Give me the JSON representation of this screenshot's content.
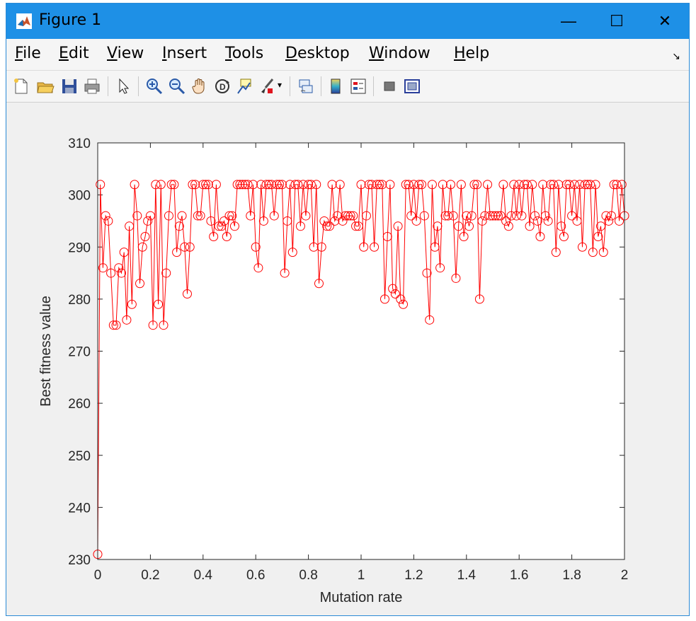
{
  "window": {
    "title": "Figure 1"
  },
  "title_controls": {
    "minimize": "—",
    "maximize": "☐",
    "close": "✕"
  },
  "menu": [
    {
      "label": "File",
      "key": "F",
      "rest": "ile"
    },
    {
      "label": "Edit",
      "key": "E",
      "rest": "dit"
    },
    {
      "label": "View",
      "key": "V",
      "rest": "iew"
    },
    {
      "label": "Insert",
      "key": "I",
      "rest": "nsert"
    },
    {
      "label": "Tools",
      "key": "T",
      "rest": "ools"
    },
    {
      "label": "Desktop",
      "key": "D",
      "rest": "esktop"
    },
    {
      "label": "Window",
      "key": "W",
      "rest": "indow"
    },
    {
      "label": "Help",
      "key": "H",
      "rest": "elp"
    }
  ],
  "toolbar_icons": [
    "new-figure-icon",
    "open-file-icon",
    "save-icon",
    "print-icon",
    "pointer-icon",
    "zoom-in-icon",
    "zoom-out-icon",
    "pan-icon",
    "rotate-3d-icon",
    "data-cursor-icon",
    "brush-icon",
    "dropdown-arrow-icon",
    "link-plot-icon",
    "colorbar-icon",
    "legend-icon",
    "hide-plot-tools-icon",
    "show-plot-tools-icon"
  ],
  "colors": {
    "titlebar": "#1e90e6",
    "series": "#ff0000"
  },
  "chart_data": {
    "type": "line",
    "xlabel": "Mutation rate",
    "ylabel": "Best fitness value",
    "xlim": [
      0,
      2
    ],
    "ylim": [
      230,
      310
    ],
    "xticks": [
      0,
      0.2,
      0.4,
      0.6,
      0.8,
      1,
      1.2,
      1.4,
      1.6,
      1.8,
      2
    ],
    "xtick_labels": [
      "0",
      "0.2",
      "0.4",
      "0.6",
      "0.8",
      "1",
      "1.2",
      "1.4",
      "1.6",
      "1.8",
      "2"
    ],
    "yticks": [
      230,
      240,
      250,
      260,
      270,
      280,
      290,
      300,
      310
    ],
    "ytick_labels": [
      "230",
      "240",
      "250",
      "260",
      "270",
      "280",
      "290",
      "300",
      "310"
    ],
    "marker": "circle",
    "series": [
      {
        "x": [
          0.0,
          0.01,
          0.02,
          0.03,
          0.04,
          0.05,
          0.06,
          0.07,
          0.08,
          0.09,
          0.1,
          0.11,
          0.12,
          0.13,
          0.14,
          0.15,
          0.16,
          0.17,
          0.18,
          0.19,
          0.2,
          0.21,
          0.22,
          0.23,
          0.24,
          0.25,
          0.26,
          0.27,
          0.28,
          0.29,
          0.3,
          0.31,
          0.32,
          0.33,
          0.34,
          0.35,
          0.36,
          0.37,
          0.38,
          0.39,
          0.4,
          0.41,
          0.42,
          0.43,
          0.44,
          0.45,
          0.46,
          0.47,
          0.48,
          0.49,
          0.5,
          0.51,
          0.52,
          0.53,
          0.54,
          0.55,
          0.56,
          0.57,
          0.58,
          0.59,
          0.6,
          0.61,
          0.62,
          0.63,
          0.64,
          0.65,
          0.66,
          0.67,
          0.68,
          0.69,
          0.7,
          0.71,
          0.72,
          0.73,
          0.74,
          0.75,
          0.76,
          0.77,
          0.78,
          0.79,
          0.8,
          0.81,
          0.82,
          0.83,
          0.84,
          0.85,
          0.86,
          0.87,
          0.88,
          0.89,
          0.9,
          0.91,
          0.92,
          0.93,
          0.94,
          0.95,
          0.96,
          0.97,
          0.98,
          0.99,
          1.0,
          1.01,
          1.02,
          1.03,
          1.04,
          1.05,
          1.06,
          1.07,
          1.08,
          1.09,
          1.1,
          1.11,
          1.12,
          1.13,
          1.14,
          1.15,
          1.16,
          1.17,
          1.18,
          1.19,
          1.2,
          1.21,
          1.22,
          1.23,
          1.24,
          1.25,
          1.26,
          1.27,
          1.28,
          1.29,
          1.3,
          1.31,
          1.32,
          1.33,
          1.34,
          1.35,
          1.36,
          1.37,
          1.38,
          1.39,
          1.4,
          1.41,
          1.42,
          1.43,
          1.44,
          1.45,
          1.46,
          1.47,
          1.48,
          1.49,
          1.5,
          1.51,
          1.52,
          1.53,
          1.54,
          1.55,
          1.56,
          1.57,
          1.58,
          1.59,
          1.6,
          1.61,
          1.62,
          1.63,
          1.64,
          1.65,
          1.66,
          1.67,
          1.68,
          1.69,
          1.7,
          1.71,
          1.72,
          1.73,
          1.74,
          1.75,
          1.76,
          1.77,
          1.78,
          1.79,
          1.8,
          1.81,
          1.82,
          1.83,
          1.84,
          1.85,
          1.86,
          1.87,
          1.88,
          1.89,
          1.9,
          1.91,
          1.92,
          1.93,
          1.94,
          1.95,
          1.96,
          1.97,
          1.98,
          1.99,
          2.0
        ],
        "y": [
          231,
          302,
          286,
          296,
          295,
          285,
          275,
          275,
          286,
          285,
          289,
          276,
          294,
          279,
          302,
          296,
          283,
          290,
          292,
          295,
          296,
          275,
          302,
          279,
          302,
          275,
          285,
          296,
          302,
          302,
          289,
          294,
          296,
          290,
          281,
          290,
          302,
          302,
          296,
          296,
          302,
          302,
          302,
          295,
          292,
          302,
          294,
          294,
          295,
          292,
          296,
          296,
          294,
          302,
          302,
          302,
          302,
          302,
          296,
          302,
          290,
          286,
          302,
          295,
          302,
          302,
          302,
          296,
          302,
          302,
          302,
          285,
          295,
          302,
          289,
          302,
          302,
          294,
          302,
          296,
          302,
          302,
          290,
          302,
          283,
          290,
          295,
          294,
          294,
          302,
          295,
          296,
          302,
          295,
          296,
          296,
          296,
          296,
          294,
          294,
          302,
          290,
          296,
          302,
          302,
          290,
          302,
          302,
          302,
          280,
          292,
          302,
          282,
          281,
          294,
          280,
          279,
          302,
          302,
          296,
          302,
          295,
          302,
          302,
          296,
          285,
          276,
          302,
          290,
          294,
          286,
          302,
          296,
          296,
          302,
          296,
          284,
          294,
          302,
          292,
          296,
          294,
          296,
          302,
          302,
          280,
          295,
          296,
          302,
          296,
          296,
          296,
          296,
          296,
          302,
          295,
          294,
          296,
          302,
          296,
          302,
          296,
          302,
          302,
          294,
          302,
          296,
          295,
          292,
          302,
          296,
          295,
          302,
          302,
          289,
          302,
          294,
          292,
          302,
          302,
          296,
          302,
          295,
          302,
          290,
          302,
          302,
          302,
          289,
          302,
          292,
          294,
          289,
          296,
          295,
          296,
          302,
          302,
          295,
          302,
          296
        ]
      }
    ]
  }
}
